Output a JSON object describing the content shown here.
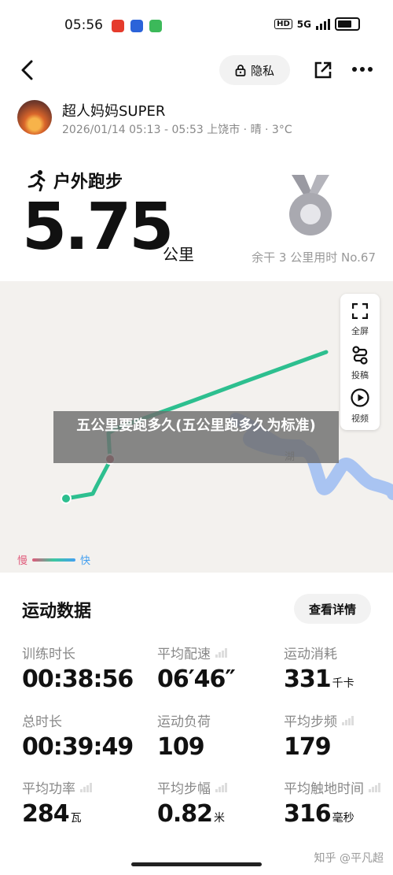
{
  "status_bar": {
    "time": "05:56",
    "network": "5G",
    "hd": "HD"
  },
  "top_bar": {
    "privacy_label": "隐私"
  },
  "user": {
    "name": "超人妈妈SUPER",
    "meta": "2026/01/14 05:13 - 05:53 上饶市 · 晴 · 3°C"
  },
  "workout": {
    "type": "户外跑步",
    "distance": "5.75",
    "unit": "公里",
    "rank": "余干 3 公里用时 No.67"
  },
  "map": {
    "controls": {
      "fullscreen": "全屏",
      "cast": "投稿",
      "video": "视频"
    },
    "place_label": "湖",
    "legend": {
      "slow": "慢",
      "fast": "快"
    },
    "banner": "五公里要跑多久(五公里跑多久为标准)"
  },
  "stats": {
    "title": "运动数据",
    "detail_button": "查看详情",
    "items": [
      {
        "label": "训练时长",
        "value": "00:38:56",
        "unit": ""
      },
      {
        "label": "平均配速",
        "value": "06′46″",
        "unit": ""
      },
      {
        "label": "运动消耗",
        "value": "331",
        "unit": "千卡"
      },
      {
        "label": "总时长",
        "value": "00:39:49",
        "unit": ""
      },
      {
        "label": "运动负荷",
        "value": "109",
        "unit": ""
      },
      {
        "label": "平均步频",
        "value": "179",
        "unit": ""
      },
      {
        "label": "平均功率",
        "value": "284",
        "unit": "瓦"
      },
      {
        "label": "平均步幅",
        "value": "0.82",
        "unit": "米"
      },
      {
        "label": "平均触地时间",
        "value": "316",
        "unit": "毫秒"
      }
    ]
  },
  "watermark": "知乎 @平凡超",
  "colors": {
    "route": "#2dbf8f",
    "water": "#a9c4f2",
    "start": "#2dbf8f",
    "end": "#b43a4a"
  }
}
